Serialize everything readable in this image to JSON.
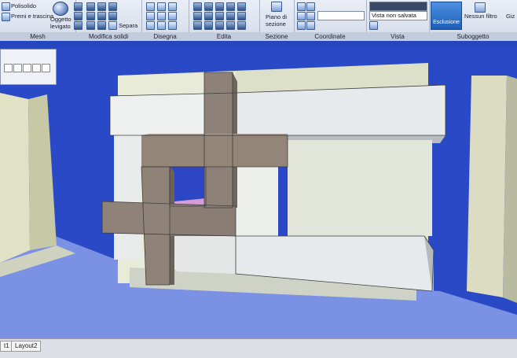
{
  "ribbon": {
    "panels": [
      {
        "label": "Mesh",
        "items": [
          "Polisolido",
          "Premi e trascina",
          "Oggetto",
          "levigato"
        ]
      },
      {
        "label": "Modifica solidi",
        "items": [
          "Separa"
        ]
      },
      {
        "label": "Disegna",
        "items": []
      },
      {
        "label": "Edita",
        "items": []
      },
      {
        "label": "Sezione",
        "items": [
          "Piano di",
          "sezione"
        ]
      },
      {
        "label": "Coordinate",
        "items": []
      },
      {
        "label": "Vista",
        "items": [
          "Vista non salvata"
        ]
      },
      {
        "label": "Suboggetto",
        "items": [
          "Esclusione",
          "Nessun filtro",
          "Giz"
        ]
      }
    ]
  },
  "tabs": [
    "t1",
    "Layout2"
  ],
  "colors": {
    "viewport_bg": "#2646c0",
    "wall_light": "#d8dcc2",
    "box_face": "#e4e8ea",
    "cross_face": "#8e8278"
  }
}
